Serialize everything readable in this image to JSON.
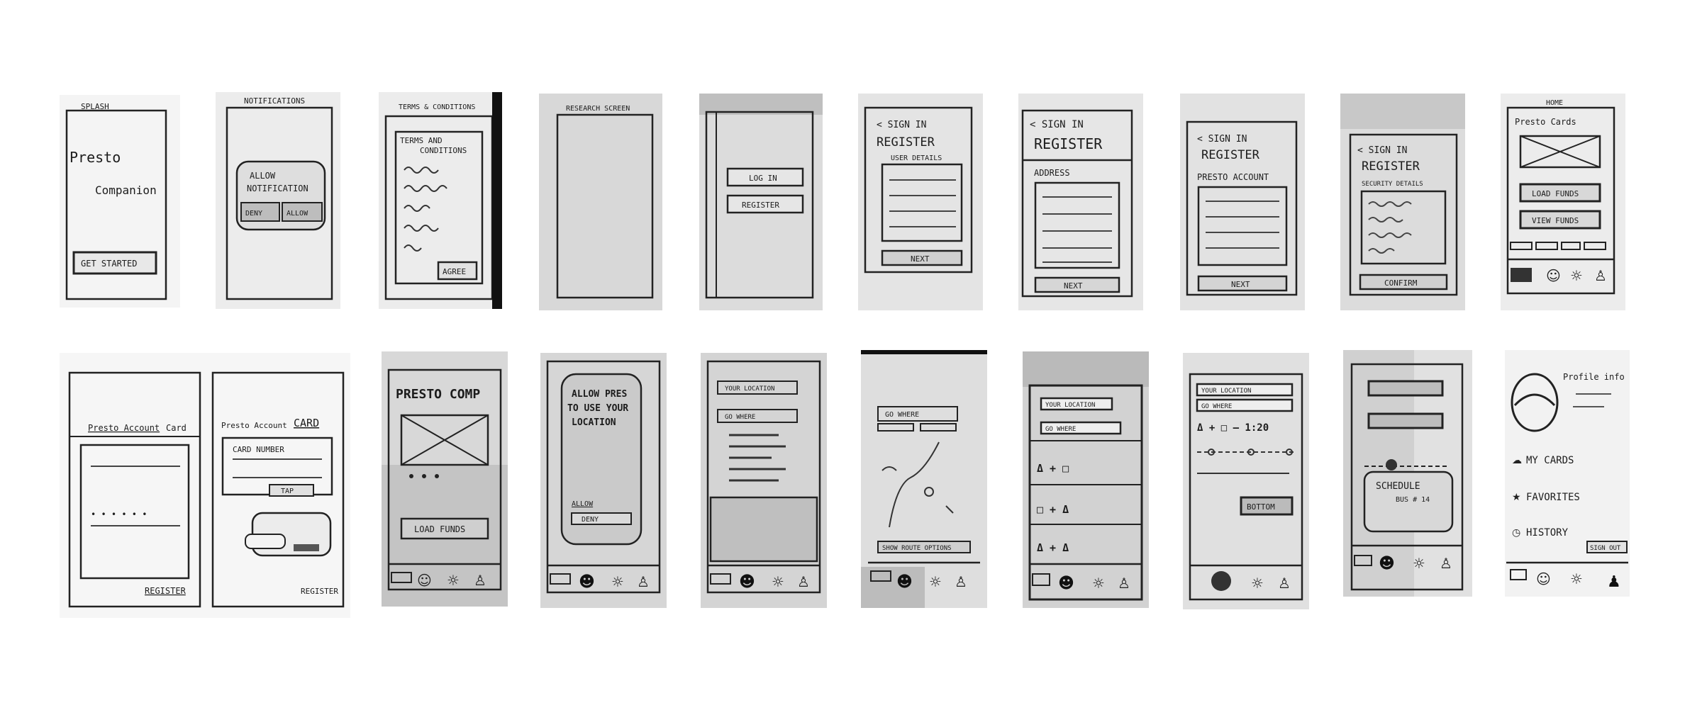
{
  "sketches_row1": [
    {
      "header": "SPLASH",
      "title": "Presto",
      "subtitle": "Companion",
      "button": "GET STARTED"
    },
    {
      "header": "NOTIFICATIONS",
      "prompt_line1": "ALLOW",
      "prompt_line2": "NOTIFICATION",
      "btn_left": "DENY",
      "btn_right": "ALLOW"
    },
    {
      "header": "TERMS & CONDITIONS",
      "title_line1": "TERMS AND",
      "title_line2": "CONDITIONS",
      "button": "AGREE"
    },
    {
      "header": "RESEARCH SCREEN"
    },
    {
      "btn_login": "LOG IN",
      "btn_register": "REGISTER"
    },
    {
      "back": "< SIGN IN",
      "title": "REGISTER",
      "section": "USER DETAILS",
      "button": "NEXT"
    },
    {
      "back": "< SIGN IN",
      "title": "REGISTER",
      "section": "ADDRESS",
      "button": "NEXT"
    },
    {
      "back": "< SIGN IN",
      "title": "REGISTER",
      "section": "PRESTO ACCOUNT",
      "button": "NEXT"
    },
    {
      "back": "< SIGN IN",
      "title": "REGISTER",
      "section": "SECURITY DETAILS",
      "button": "CONFIRM"
    },
    {
      "header": "HOME",
      "title": "Presto Cards",
      "btn1": "LOAD FUNDS",
      "btn2": "VIEW FUNDS"
    }
  ],
  "sketches_row2": [
    {
      "left_tab1": "Presto Account",
      "left_tab2": "Card",
      "left_footer": "REGISTER",
      "right_tab1": "Presto Account",
      "right_tab2": "CARD",
      "right_field": "CARD NUMBER",
      "right_btn": "TAP",
      "right_footer": "REGISTER"
    },
    {
      "title": "PRESTO COMP",
      "button": "LOAD FUNDS"
    },
    {
      "title_line1": "ALLOW PRES",
      "title_line2": "TO USE YOUR",
      "title_line3": "LOCATION",
      "btn1": "ALLOW",
      "btn2": "DENY"
    },
    {
      "field1": "YOUR LOCATION",
      "field2": "GO WHERE"
    },
    {
      "field": "GO WHERE",
      "footer": "SHOW ROUTE OPTIONS"
    },
    {
      "field1": "YOUR LOCATION",
      "field2": "GO WHERE",
      "route1": "Δ + □",
      "route2": "□ + Δ",
      "route3": "Δ + Δ"
    },
    {
      "field1": "YOUR LOCATION",
      "field2": "GO WHERE",
      "route": "Δ + □ — 1:20",
      "button": "BOTTOM"
    },
    {
      "card_title": "SCHEDULE",
      "card_text": "BUS # 14"
    },
    {
      "header": "Profile info",
      "item1": "MY CARDS",
      "item2": "FAVORITES",
      "item3": "HISTORY",
      "button": "SIGN OUT"
    }
  ]
}
